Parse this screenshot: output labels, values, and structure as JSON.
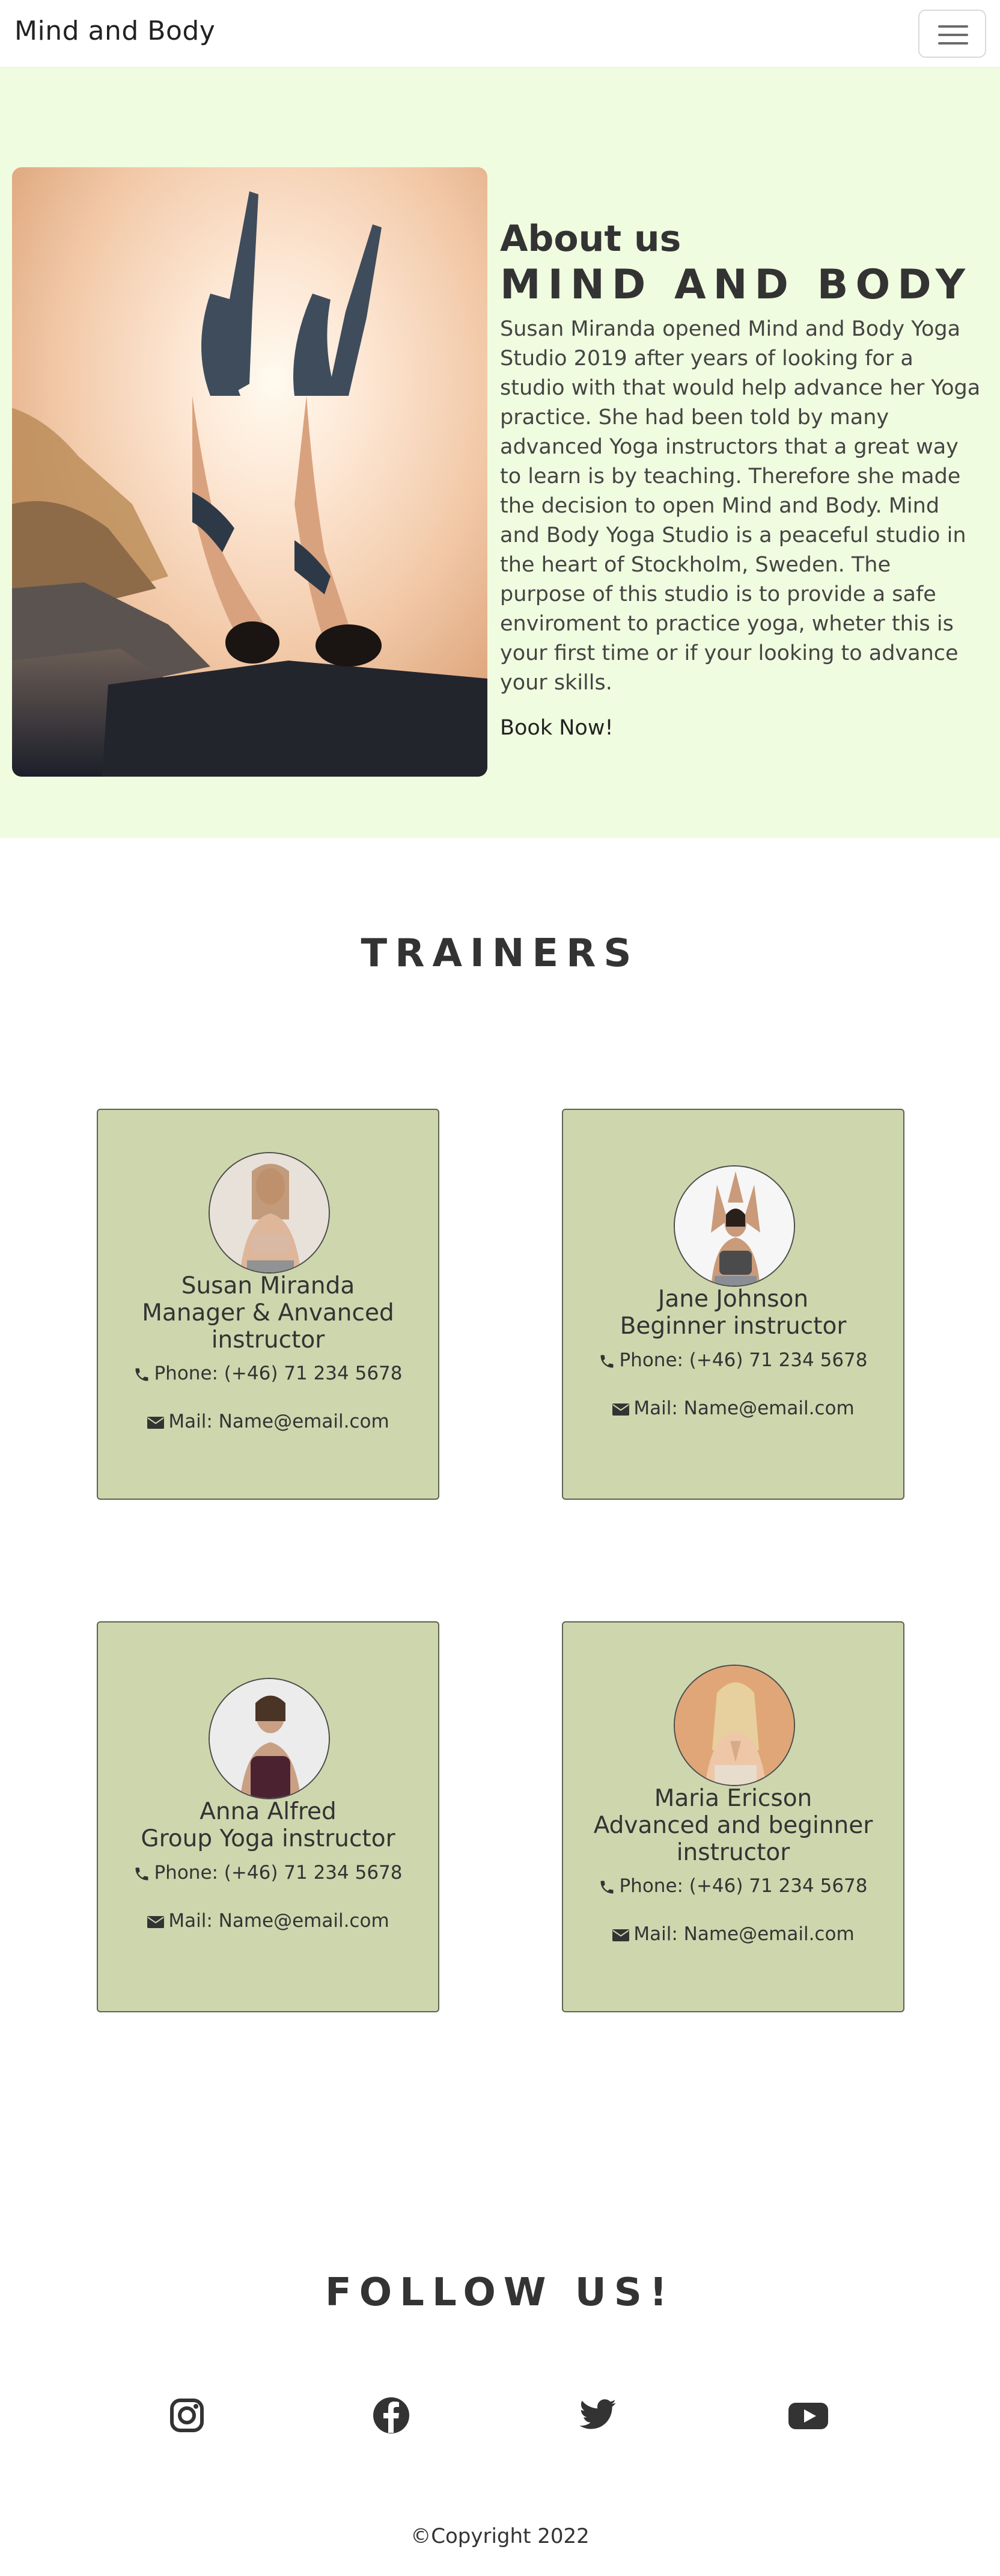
{
  "navbar": {
    "brand": "Mind and Body"
  },
  "about": {
    "heading": "About us",
    "title": "MIND AND BODY",
    "body": "Susan Miranda opened Mind and Body Yoga Studio 2019 after years of looking for a studio with that would help advance her Yoga practice. She had been told by many advanced Yoga instructors that a great way to learn is by teaching. Therefore she made the decision to open Mind and Body. Mind and Body Yoga Studio is a peaceful studio in the heart of Stockholm, Sweden. The purpose of this studio is to provide a safe enviroment to practice yoga, wheter this is your first time or if your looking to advance your skills.",
    "cta": "Book Now!"
  },
  "trainers": {
    "title": "TRAINERS",
    "items": [
      {
        "name": "Susan Miranda",
        "role": "Manager & Anvanced instructor",
        "phone": "Phone: (+46) 71 234 5678",
        "mail": "Mail: Name@email.com"
      },
      {
        "name": "Jane Johnson",
        "role": "Beginner instructor",
        "phone": "Phone: (+46) 71 234 5678",
        "mail": "Mail: Name@email.com"
      },
      {
        "name": "Anna Alfred",
        "role": "Group Yoga instructor",
        "phone": "Phone: (+46) 71 234 5678",
        "mail": "Mail: Name@email.com"
      },
      {
        "name": "Maria Ericson",
        "role": "Advanced and beginner instructor",
        "phone": "Phone: (+46) 71 234 5678",
        "mail": "Mail: Name@email.com"
      }
    ]
  },
  "follow": {
    "title": "FOLLOW US!",
    "icons": [
      "instagram-icon",
      "facebook-icon",
      "twitter-icon",
      "youtube-icon"
    ]
  },
  "footer": {
    "copyright": "©Copyright 2022"
  },
  "colors": {
    "about_bg": "#f0fcdf",
    "card_bg": "#ced6ae",
    "text": "#333333"
  }
}
